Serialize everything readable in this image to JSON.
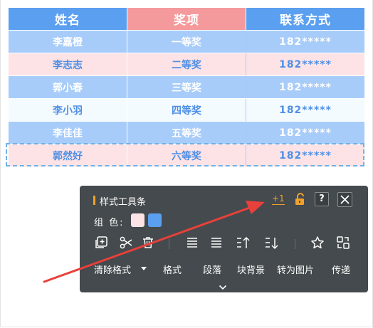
{
  "table": {
    "headers": [
      "姓名",
      "奖项",
      "联系方式"
    ],
    "rows": [
      {
        "name": "李嘉橙",
        "award": "一等奖",
        "phone": "182*****"
      },
      {
        "name": "李志志",
        "award": "二等奖",
        "phone": "182*****"
      },
      {
        "name": "郭小春",
        "award": "三等奖",
        "phone": "182*****"
      },
      {
        "name": "李小羽",
        "award": "四等奖",
        "phone": "182*****"
      },
      {
        "name": "李佳佳",
        "award": "五等奖",
        "phone": "182*****"
      },
      {
        "name": "郭然好",
        "award": "六等奖",
        "phone": "182*****"
      }
    ],
    "colors": {
      "header_blue": "#5b9ff0",
      "header_pink": "#f59a9c",
      "row_blue": "#a7ccf9",
      "row_pink": "#fde3e6",
      "row_white": "#f4fbff",
      "text_blue": "#4f8fe5"
    }
  },
  "toolbar": {
    "title": "样式工具条",
    "counter": "+1",
    "help": "?",
    "color_label": "组 色:",
    "swatches": [
      "#fde3e6",
      "#5b9ff0"
    ],
    "icons": [
      "copy-add-icon",
      "scissors-icon",
      "trash-icon",
      "align-top-icon",
      "align-justify-icon",
      "sort-up-icon",
      "sort-down-icon",
      "star-icon",
      "swap-icon"
    ],
    "labels": {
      "clear_format": "清除格式",
      "format": "格式",
      "paragraph": "段落",
      "block_background": "块背景",
      "to_image": "转为图片",
      "share": "传递"
    },
    "accent_color": "#f2a12b",
    "background": "#444a4d"
  },
  "arrow_color": "#e8403a"
}
